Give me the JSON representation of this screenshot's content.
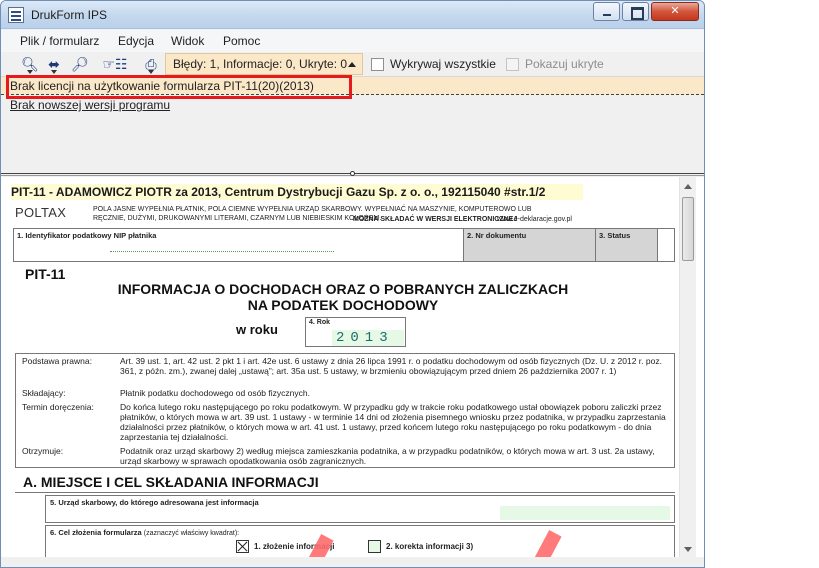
{
  "window": {
    "title": "DrukForm IPS",
    "controls": {
      "minimize": "",
      "maximize": "",
      "close": "✕"
    }
  },
  "menu": {
    "items": [
      "Plik / formularz",
      "Edycja",
      "Widok",
      "Pomoc"
    ]
  },
  "toolbar": {
    "status_text": "Błędy: 1, Informacje: 0, Ukryte: 0",
    "detect_all_label": "Wykrywaj wszystkie",
    "show_hidden_label": "Pokazuj ukryte",
    "icons": [
      "zoom-out-icon",
      "fit-width-icon",
      "zoom-in-icon",
      "go-to-field-icon",
      "print-icon"
    ]
  },
  "messages": {
    "license": "Brak licencji na użytkowanie formularza PIT-11(20)(2013)",
    "version": "Brak nowszej wersji programu"
  },
  "document": {
    "header": "PIT-11 - ADAMOWICZ PIOTR za 2013, Centrum Dystrybucji Gazu Sp. z o. o., 192115040 #str.1/2",
    "poltax": "POLTAX",
    "fill_note": "POLA JASNE WYPEŁNIA PŁATNIK, POLA CIEMNE WYPEŁNIA URZĄD SKARBOWY. WYPEŁNIAĆ NA MASZYNIE, KOMPUTEROWO LUB RĘCZNIE, DUŻYMI, DRUKOWANYMI LITERAMI, CZARNYM LUB NIEBIESKIM KOLOREM.",
    "online_note": "MOŻNA SKŁADAĆ W WERSJI ELEKTRONICZNEJ",
    "online_url": "www.e-deklaracje.gov.pl",
    "nip_label": "1. Identyfikator podatkowy NIP płatnika",
    "doc_no_label": "2. Nr dokumentu",
    "status_label": "3. Status",
    "form_code": "PIT-11",
    "title_line1": "INFORMACJA O DOCHODACH ORAZ O POBRANYCH ZALICZKACH",
    "title_line2": "NA PODATEK DOCHODOWY",
    "year_prefix": "w roku",
    "year_label": "4. Rok",
    "year_value": "2013",
    "info": [
      {
        "label": "Podstawa prawna:",
        "text": "Art. 39 ust. 1, art. 42 ust. 2 pkt 1 i art. 42e ust. 6 ustawy z dnia 26 lipca 1991 r. o podatku dochodowym od osób fizycznych (Dz. U. z 2012 r. poz. 361, z późn. zm.), zwanej dalej „ustawą”; art. 35a ust. 5 ustawy, w brzmieniu obowiązującym przed dniem 26 października 2007 r. 1)"
      },
      {
        "label": "Składający:",
        "text": "Płatnik podatku dochodowego od osób fizycznych."
      },
      {
        "label": "Termin doręczenia:",
        "text": "Do końca lutego roku następującego po roku podatkowym. W przypadku gdy w trakcie roku podatkowego ustał obowiązek poboru zaliczki przez płatników, o których mowa w art. 39 ust. 1 ustawy - w terminie 14 dni od złożenia pisemnego wniosku przez podatnika, w przypadku zaprzestania działalności przez płatników, o których mowa w art. 41 ust. 1 ustawy, przed końcem lutego roku następującego po roku podatkowym - do dnia zaprzestania tej działalności."
      },
      {
        "label": "Otrzymuje:",
        "text": "Podatnik oraz urząd skarbowy 2) według miejsca zamieszkania podatnika, a w przypadku podatników, o których mowa w art. 3 ust. 2a ustawy, urząd skarbowy w sprawach opodatkowania osób zagranicznych."
      }
    ],
    "section_a": "A. MIEJSCE I CEL SKŁADANIA INFORMACJI",
    "field5_label": "5. Urząd skarbowy, do którego adresowana jest informacja",
    "field6_label": "6. Cel złożenia formularza",
    "field6_hint": "(zaznaczyć właściwy kwadrat):",
    "choice1": "1. złożenie informacji",
    "choice2": "2. korekta informacji 3)"
  }
}
